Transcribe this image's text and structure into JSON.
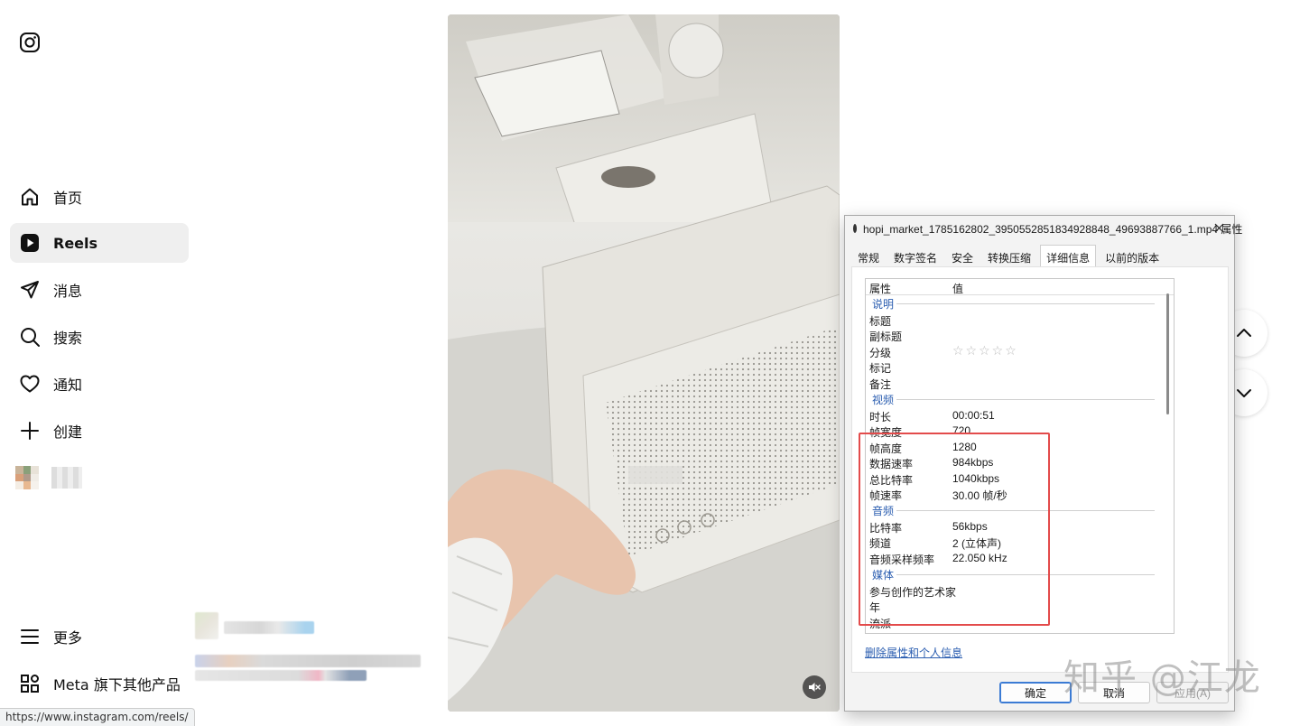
{
  "sidebar": {
    "items": [
      {
        "label": "首页",
        "icon": "home-icon"
      },
      {
        "label": "Reels",
        "icon": "reels-icon"
      },
      {
        "label": "消息",
        "icon": "messages-icon"
      },
      {
        "label": "搜索",
        "icon": "search-icon"
      },
      {
        "label": "通知",
        "icon": "heart-icon"
      },
      {
        "label": "创建",
        "icon": "plus-icon"
      }
    ],
    "more": "更多",
    "meta": "Meta 旗下其他产品"
  },
  "status_url": "https://www.instagram.com/reels/",
  "watermark": "知乎 @江龙",
  "dialog": {
    "title": "hopi_market_1785162802_3950552851834928848_49693887766_1.mp4 属性",
    "tabs": [
      "常规",
      "数字签名",
      "安全",
      "转换压缩",
      "详细信息",
      "以前的版本"
    ],
    "active_tab": "详细信息",
    "header": {
      "property": "属性",
      "value": "值"
    },
    "groups": {
      "description": "说明",
      "video": "视频",
      "audio": "音频",
      "media": "媒体"
    },
    "rows": {
      "title": {
        "k": "标题",
        "v": ""
      },
      "subtitle": {
        "k": "副标题",
        "v": ""
      },
      "rating": {
        "k": "分级",
        "v": "☆☆☆☆☆"
      },
      "tags": {
        "k": "标记",
        "v": ""
      },
      "comments": {
        "k": "备注",
        "v": ""
      },
      "duration": {
        "k": "时长",
        "v": "00:00:51"
      },
      "frame_width": {
        "k": "帧宽度",
        "v": "720"
      },
      "frame_height": {
        "k": "帧高度",
        "v": "1280"
      },
      "data_rate": {
        "k": "数据速率",
        "v": "984kbps"
      },
      "total_bitrate": {
        "k": "总比特率",
        "v": "1040kbps"
      },
      "frame_rate": {
        "k": "帧速率",
        "v": "30.00 帧/秒"
      },
      "audio_bitrate": {
        "k": "比特率",
        "v": "56kbps"
      },
      "channels": {
        "k": "频道",
        "v": "2 (立体声)"
      },
      "sample_rate": {
        "k": "音频采样频率",
        "v": "22.050 kHz"
      },
      "contributing_artists": {
        "k": "参与创作的艺术家",
        "v": ""
      },
      "year": {
        "k": "年",
        "v": ""
      },
      "genre": {
        "k": "流派",
        "v": ""
      }
    },
    "remove_link": "删除属性和个人信息",
    "buttons": {
      "ok": "确定",
      "cancel": "取消",
      "apply": "应用(A)"
    },
    "highlight_color": "#e34b4b"
  }
}
